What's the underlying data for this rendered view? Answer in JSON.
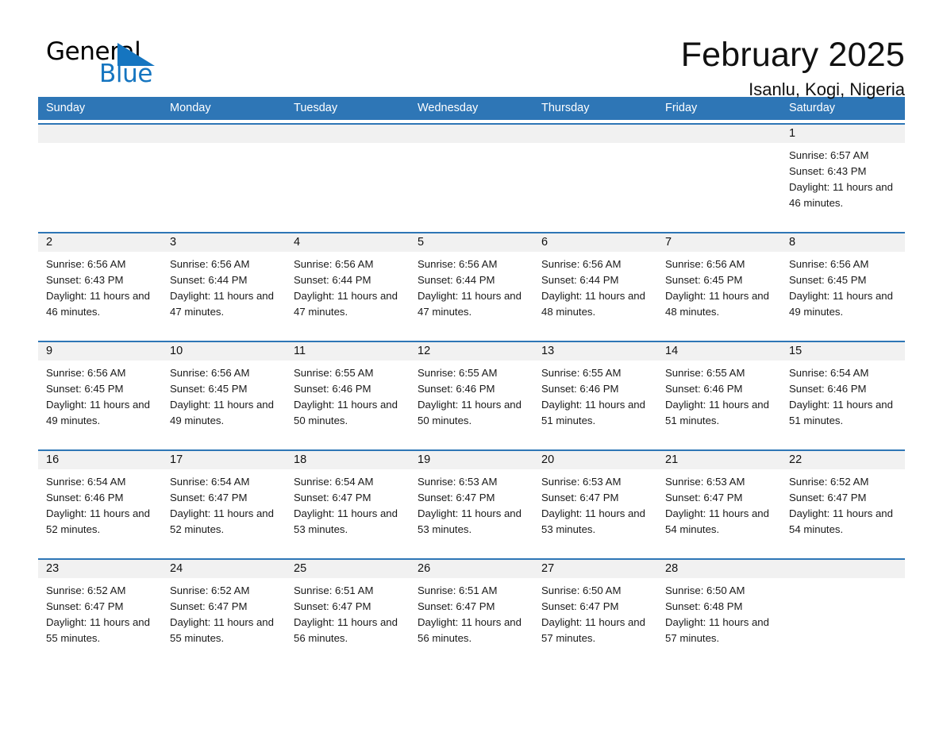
{
  "brand": {
    "name_top": "General",
    "name_bottom": "Blue",
    "flag_color": "#1575c0",
    "top_color": "#000000"
  },
  "header": {
    "month_title": "February 2025",
    "location": "Isanlu, Kogi, Nigeria"
  },
  "theme": {
    "header_blue": "#2e76b6",
    "daynum_band": "#f1f1f1",
    "text": "#1a1a1a"
  },
  "weekdays": [
    "Sunday",
    "Monday",
    "Tuesday",
    "Wednesday",
    "Thursday",
    "Friday",
    "Saturday"
  ],
  "weeks": [
    [
      {
        "empty": true
      },
      {
        "empty": true
      },
      {
        "empty": true
      },
      {
        "empty": true
      },
      {
        "empty": true
      },
      {
        "empty": true
      },
      {
        "day": "1",
        "sunrise": "Sunrise: 6:57 AM",
        "sunset": "Sunset: 6:43 PM",
        "daylight": "Daylight: 11 hours and 46 minutes."
      }
    ],
    [
      {
        "day": "2",
        "sunrise": "Sunrise: 6:56 AM",
        "sunset": "Sunset: 6:43 PM",
        "daylight": "Daylight: 11 hours and 46 minutes."
      },
      {
        "day": "3",
        "sunrise": "Sunrise: 6:56 AM",
        "sunset": "Sunset: 6:44 PM",
        "daylight": "Daylight: 11 hours and 47 minutes."
      },
      {
        "day": "4",
        "sunrise": "Sunrise: 6:56 AM",
        "sunset": "Sunset: 6:44 PM",
        "daylight": "Daylight: 11 hours and 47 minutes."
      },
      {
        "day": "5",
        "sunrise": "Sunrise: 6:56 AM",
        "sunset": "Sunset: 6:44 PM",
        "daylight": "Daylight: 11 hours and 47 minutes."
      },
      {
        "day": "6",
        "sunrise": "Sunrise: 6:56 AM",
        "sunset": "Sunset: 6:44 PM",
        "daylight": "Daylight: 11 hours and 48 minutes."
      },
      {
        "day": "7",
        "sunrise": "Sunrise: 6:56 AM",
        "sunset": "Sunset: 6:45 PM",
        "daylight": "Daylight: 11 hours and 48 minutes."
      },
      {
        "day": "8",
        "sunrise": "Sunrise: 6:56 AM",
        "sunset": "Sunset: 6:45 PM",
        "daylight": "Daylight: 11 hours and 49 minutes."
      }
    ],
    [
      {
        "day": "9",
        "sunrise": "Sunrise: 6:56 AM",
        "sunset": "Sunset: 6:45 PM",
        "daylight": "Daylight: 11 hours and 49 minutes."
      },
      {
        "day": "10",
        "sunrise": "Sunrise: 6:56 AM",
        "sunset": "Sunset: 6:45 PM",
        "daylight": "Daylight: 11 hours and 49 minutes."
      },
      {
        "day": "11",
        "sunrise": "Sunrise: 6:55 AM",
        "sunset": "Sunset: 6:46 PM",
        "daylight": "Daylight: 11 hours and 50 minutes."
      },
      {
        "day": "12",
        "sunrise": "Sunrise: 6:55 AM",
        "sunset": "Sunset: 6:46 PM",
        "daylight": "Daylight: 11 hours and 50 minutes."
      },
      {
        "day": "13",
        "sunrise": "Sunrise: 6:55 AM",
        "sunset": "Sunset: 6:46 PM",
        "daylight": "Daylight: 11 hours and 51 minutes."
      },
      {
        "day": "14",
        "sunrise": "Sunrise: 6:55 AM",
        "sunset": "Sunset: 6:46 PM",
        "daylight": "Daylight: 11 hours and 51 minutes."
      },
      {
        "day": "15",
        "sunrise": "Sunrise: 6:54 AM",
        "sunset": "Sunset: 6:46 PM",
        "daylight": "Daylight: 11 hours and 51 minutes."
      }
    ],
    [
      {
        "day": "16",
        "sunrise": "Sunrise: 6:54 AM",
        "sunset": "Sunset: 6:46 PM",
        "daylight": "Daylight: 11 hours and 52 minutes."
      },
      {
        "day": "17",
        "sunrise": "Sunrise: 6:54 AM",
        "sunset": "Sunset: 6:47 PM",
        "daylight": "Daylight: 11 hours and 52 minutes."
      },
      {
        "day": "18",
        "sunrise": "Sunrise: 6:54 AM",
        "sunset": "Sunset: 6:47 PM",
        "daylight": "Daylight: 11 hours and 53 minutes."
      },
      {
        "day": "19",
        "sunrise": "Sunrise: 6:53 AM",
        "sunset": "Sunset: 6:47 PM",
        "daylight": "Daylight: 11 hours and 53 minutes."
      },
      {
        "day": "20",
        "sunrise": "Sunrise: 6:53 AM",
        "sunset": "Sunset: 6:47 PM",
        "daylight": "Daylight: 11 hours and 53 minutes."
      },
      {
        "day": "21",
        "sunrise": "Sunrise: 6:53 AM",
        "sunset": "Sunset: 6:47 PM",
        "daylight": "Daylight: 11 hours and 54 minutes."
      },
      {
        "day": "22",
        "sunrise": "Sunrise: 6:52 AM",
        "sunset": "Sunset: 6:47 PM",
        "daylight": "Daylight: 11 hours and 54 minutes."
      }
    ],
    [
      {
        "day": "23",
        "sunrise": "Sunrise: 6:52 AM",
        "sunset": "Sunset: 6:47 PM",
        "daylight": "Daylight: 11 hours and 55 minutes."
      },
      {
        "day": "24",
        "sunrise": "Sunrise: 6:52 AM",
        "sunset": "Sunset: 6:47 PM",
        "daylight": "Daylight: 11 hours and 55 minutes."
      },
      {
        "day": "25",
        "sunrise": "Sunrise: 6:51 AM",
        "sunset": "Sunset: 6:47 PM",
        "daylight": "Daylight: 11 hours and 56 minutes."
      },
      {
        "day": "26",
        "sunrise": "Sunrise: 6:51 AM",
        "sunset": "Sunset: 6:47 PM",
        "daylight": "Daylight: 11 hours and 56 minutes."
      },
      {
        "day": "27",
        "sunrise": "Sunrise: 6:50 AM",
        "sunset": "Sunset: 6:47 PM",
        "daylight": "Daylight: 11 hours and 57 minutes."
      },
      {
        "day": "28",
        "sunrise": "Sunrise: 6:50 AM",
        "sunset": "Sunset: 6:48 PM",
        "daylight": "Daylight: 11 hours and 57 minutes."
      },
      {
        "empty": true
      }
    ]
  ]
}
